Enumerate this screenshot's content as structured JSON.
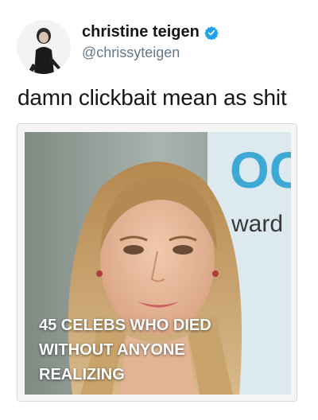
{
  "tweet": {
    "display_name": "christine teigen",
    "handle": "@chrissyteigen",
    "verified_icon": "verified-badge-icon",
    "verified_color": "#1da1f2",
    "text": "damn clickbait mean as shit"
  },
  "card": {
    "backdrop_text_top": "OC",
    "backdrop_text_bottom": "ward",
    "headline_lines": [
      "45 CELEBS WHO DIED",
      "WITHOUT ANYONE",
      "REALIZING"
    ]
  }
}
